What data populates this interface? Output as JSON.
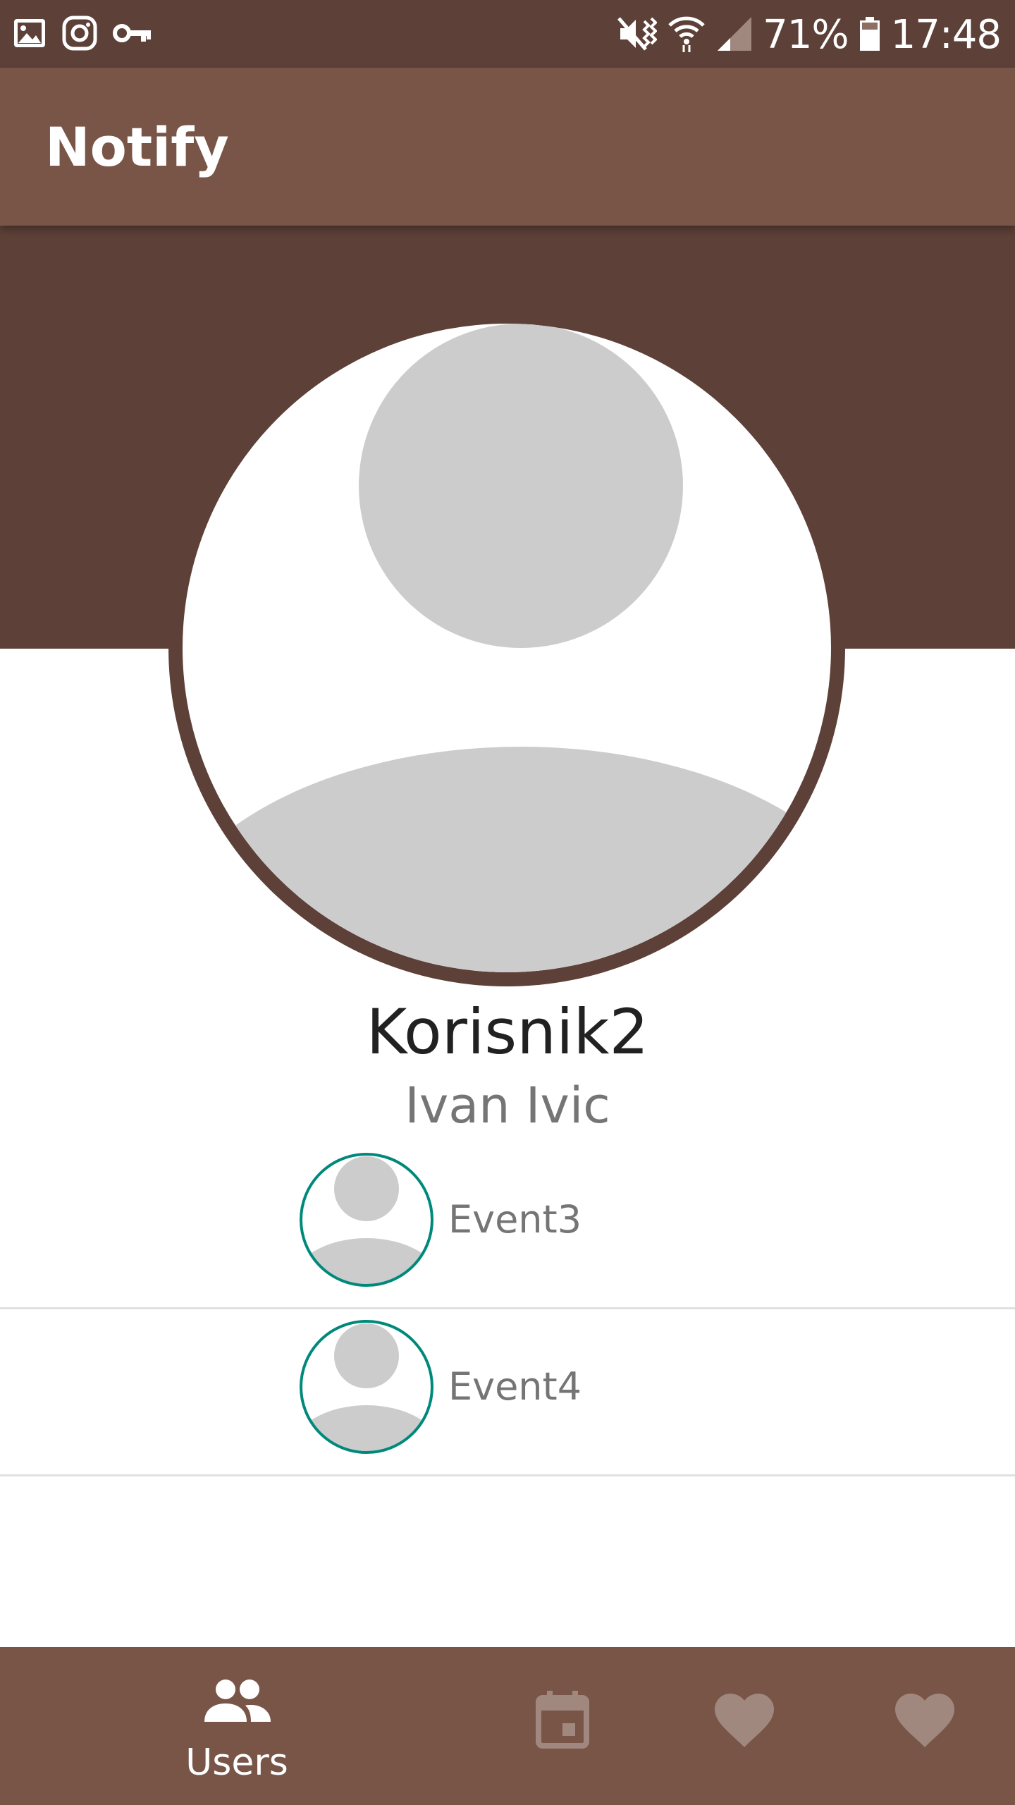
{
  "status_bar": {
    "battery": "71%",
    "time": "17:48",
    "icons_left": [
      "gallery-icon",
      "instagram-icon",
      "vpn-key-icon"
    ],
    "icons_right": [
      "mute-vibrate-icon",
      "wifi-icon",
      "cell-signal-icon",
      "battery-icon"
    ]
  },
  "app_bar": {
    "title": "Notify"
  },
  "profile": {
    "username": "Korisnik2",
    "full_name": "Ivan Ivic"
  },
  "events": [
    {
      "name": "Event3"
    },
    {
      "name": "Event4"
    }
  ],
  "bottom_nav": {
    "items": [
      {
        "label": "Users",
        "icon": "users-icon",
        "selected": true
      },
      {
        "label": "",
        "icon": "calendar-icon",
        "selected": false
      },
      {
        "label": "",
        "icon": "heart-icon",
        "selected": false
      },
      {
        "label": "",
        "icon": "heart-icon",
        "selected": false
      }
    ]
  },
  "colors": {
    "status_bar": "#5d4037",
    "app_bar": "#795548",
    "header_band": "#5d4037",
    "bottom_nav": "#795548",
    "event_avatar_border": "#00897b",
    "placeholder": "#cccccc"
  }
}
